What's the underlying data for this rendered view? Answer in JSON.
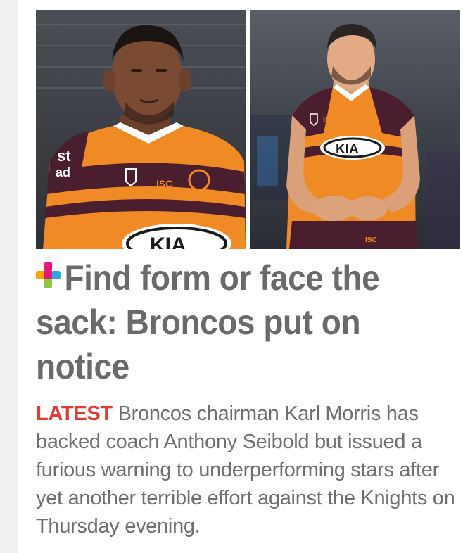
{
  "article": {
    "photos": [
      {
        "subject": "Broncos player in orange and maroon jersey (left)"
      },
      {
        "subject": "Broncos player in orange and maroon jersey (right)"
      }
    ],
    "jersey_sponsor": "KIA",
    "kit_brand": "ISC",
    "headline": "Find form or face the sack: Broncos put on notice",
    "tag": "LATEST",
    "summary": "Broncos chairman Karl Morris has backed coach Anthony Seibold but issued a furious warning to underperforming stars after yet another terrible effort against the Knights on Thursday evening."
  },
  "colors": {
    "headline": "#6a6a6a",
    "summary": "#6f6f6f",
    "tag": "#e53935",
    "rail": "#f1f1f1",
    "jersey_orange": "#f08a24",
    "jersey_maroon": "#4a1e2e"
  },
  "icons": {
    "headline_icon": "colored-plus-icon"
  }
}
